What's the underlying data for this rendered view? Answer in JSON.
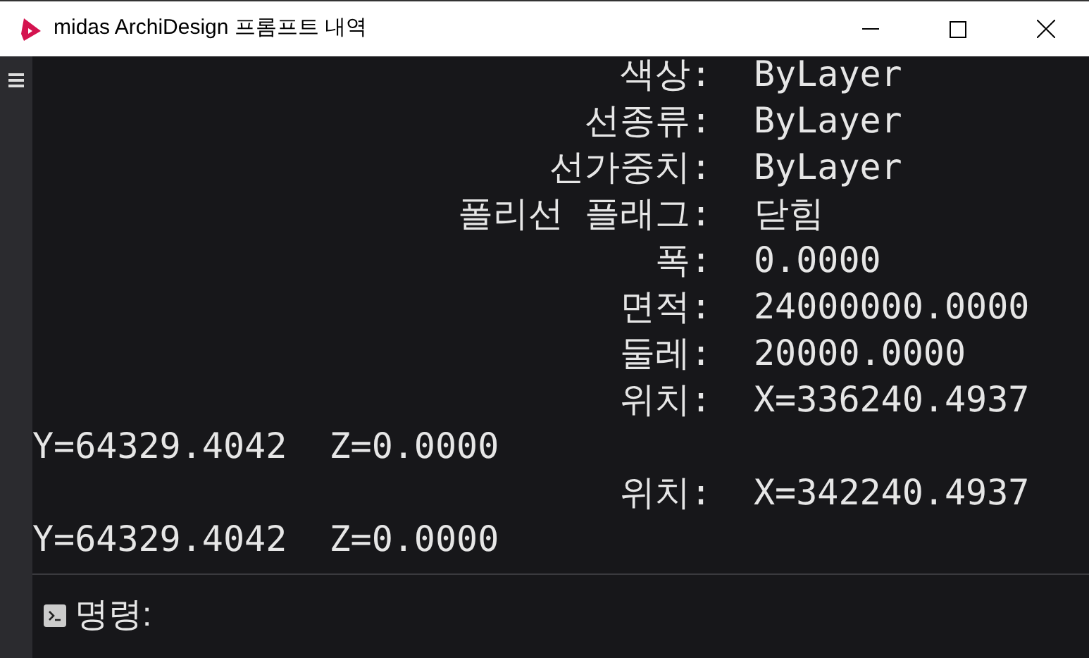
{
  "window": {
    "title": "midas ArchiDesign 프롬프트 내역"
  },
  "history": [
    {
      "kind": "field",
      "label": "색상:",
      "value": "ByLayer"
    },
    {
      "kind": "field",
      "label": "선종류:",
      "value": "ByLayer"
    },
    {
      "kind": "field",
      "label": "선가중치:",
      "value": "ByLayer"
    },
    {
      "kind": "field",
      "label": "폴리선 플래그:",
      "value": "닫힘"
    },
    {
      "kind": "field",
      "label": "폭:",
      "value": "0.0000"
    },
    {
      "kind": "field",
      "label": "면적:",
      "value": "24000000.0000"
    },
    {
      "kind": "field",
      "label": "둘레:",
      "value": "20000.0000"
    },
    {
      "kind": "field",
      "label": "위치:",
      "value": "X=336240.4937"
    },
    {
      "kind": "wrap",
      "text": "Y=64329.4042  Z=0.0000"
    },
    {
      "kind": "field",
      "label": "위치:",
      "value": "X=342240.4937"
    },
    {
      "kind": "wrap",
      "text": "Y=64329.4042  Z=0.0000"
    }
  ],
  "command": {
    "prompt": "명령:"
  }
}
